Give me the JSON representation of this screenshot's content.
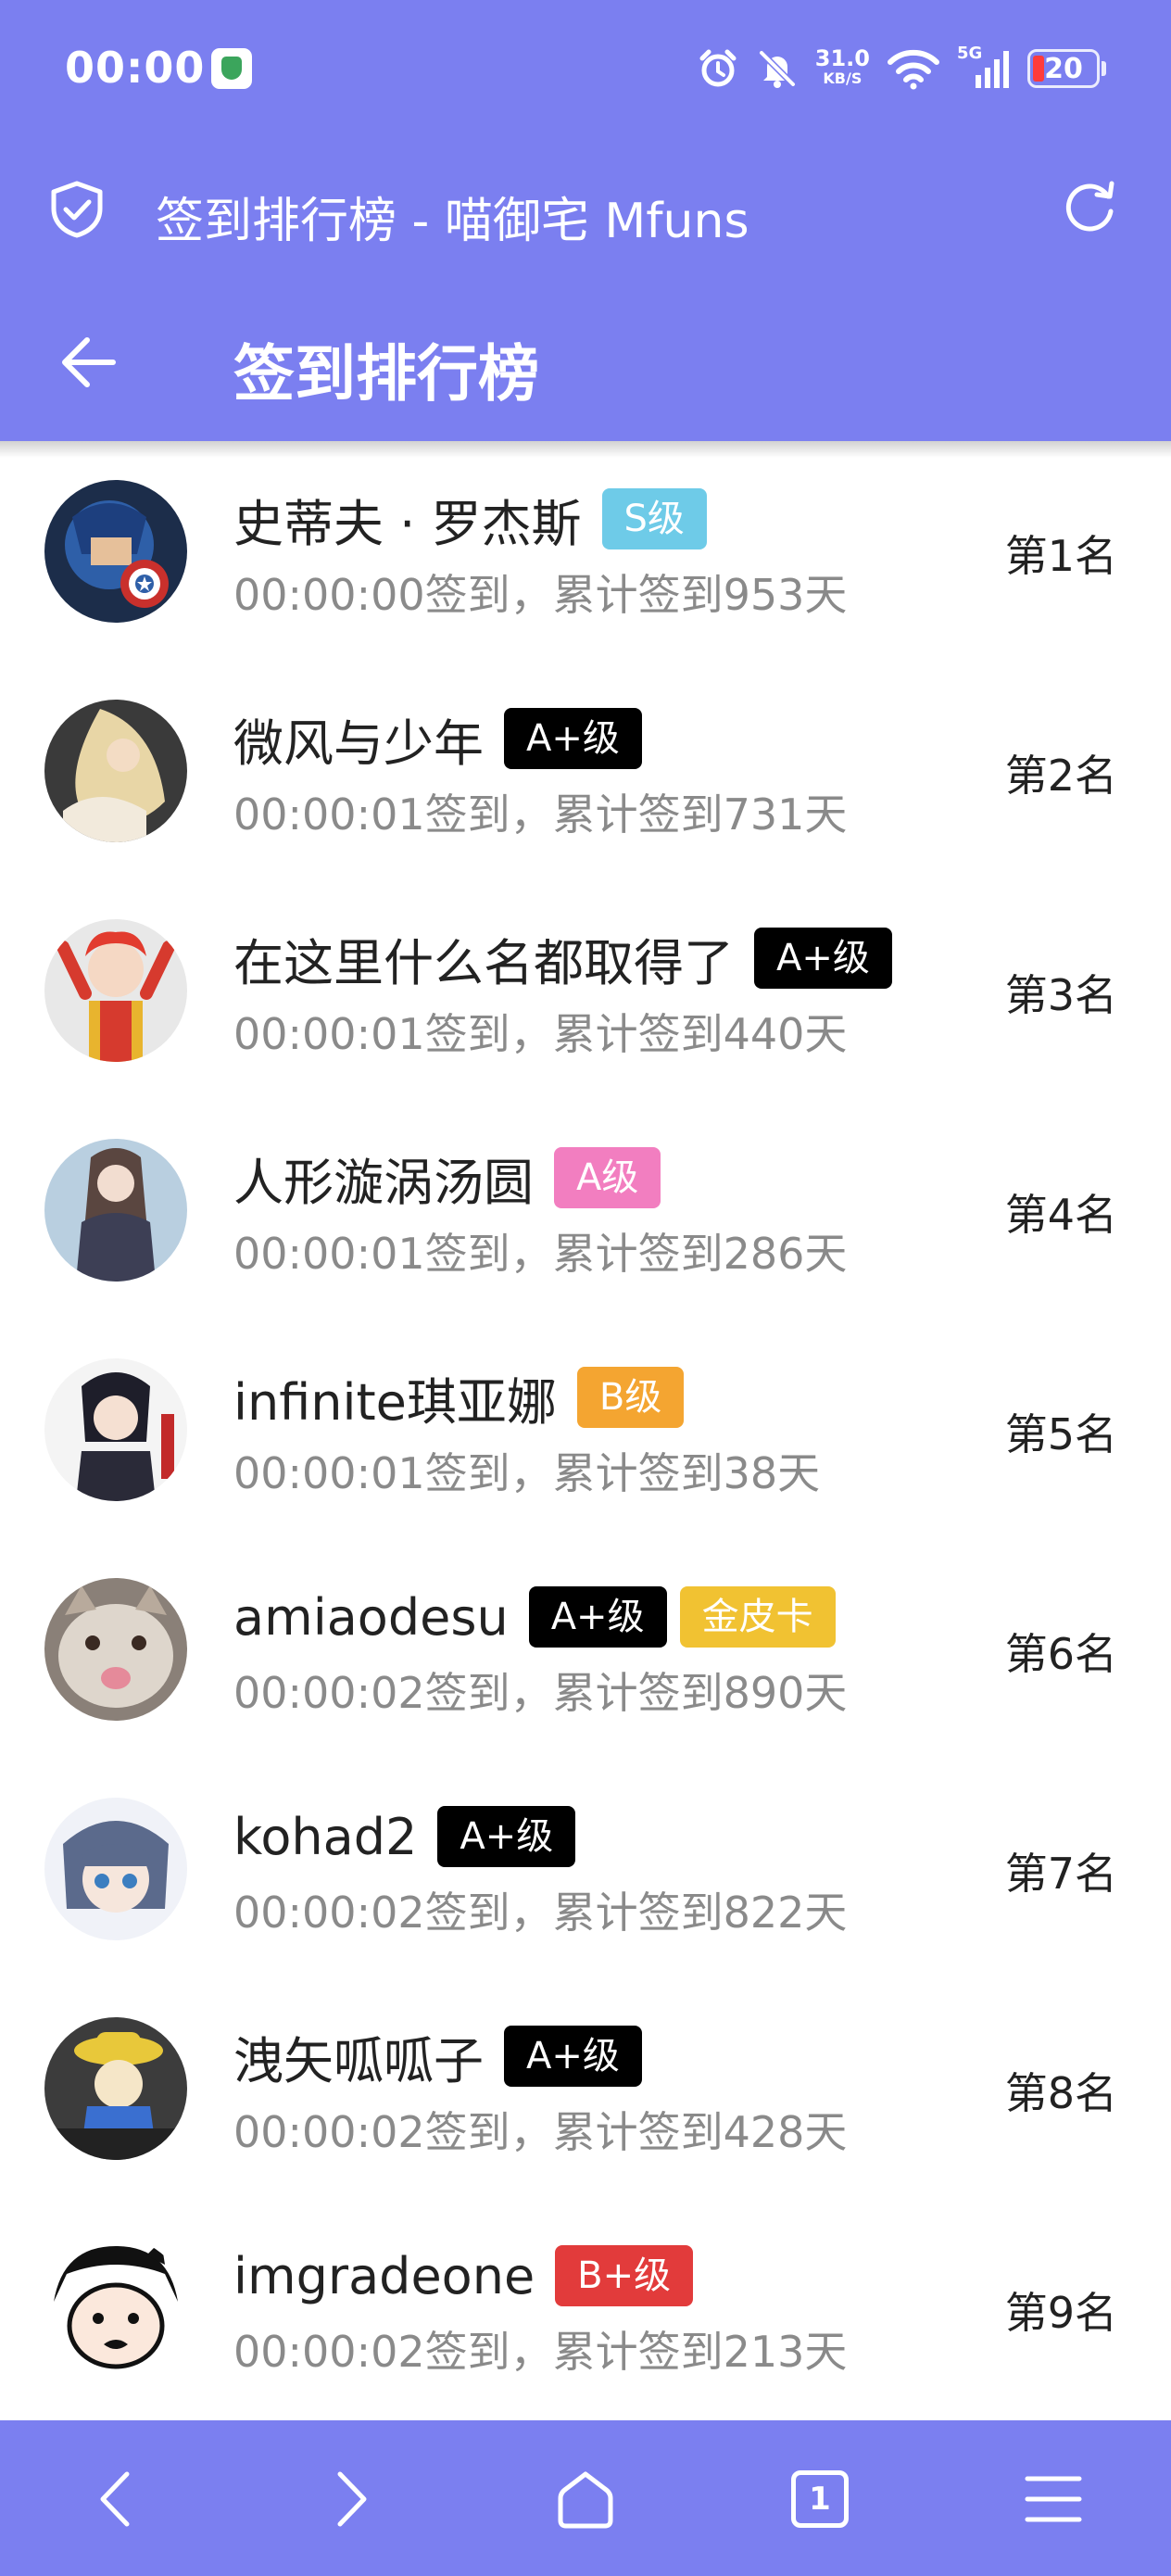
{
  "status_bar": {
    "time": "00:00",
    "net_speed": "31.0",
    "net_unit": "KB/S",
    "network": "5G",
    "battery": "20"
  },
  "browser": {
    "title": "签到排行榜 - 喵御宅 Mfuns"
  },
  "appbar": {
    "title": "签到排行榜"
  },
  "entries": [
    {
      "name": "史蒂夫 · 罗杰斯",
      "badges": [
        {
          "text": "S级",
          "color": "#6ecbe8"
        }
      ],
      "sub": "00:00:00签到，累计签到953天",
      "rank": "第1名"
    },
    {
      "name": "微风与少年",
      "badges": [
        {
          "text": "A+级",
          "color": "#000000"
        }
      ],
      "sub": "00:00:01签到，累计签到731天",
      "rank": "第2名"
    },
    {
      "name": "在这里什么名都取得了",
      "badges": [
        {
          "text": "A+级",
          "color": "#000000"
        }
      ],
      "sub": "00:00:01签到，累计签到440天",
      "rank": "第3名"
    },
    {
      "name": "人形漩涡汤圆",
      "badges": [
        {
          "text": "A级",
          "color": "#f27ec0"
        }
      ],
      "sub": "00:00:01签到，累计签到286天",
      "rank": "第4名"
    },
    {
      "name": "infinite琪亚娜",
      "badges": [
        {
          "text": "B级",
          "color": "#f4a531"
        }
      ],
      "sub": "00:00:01签到，累计签到38天",
      "rank": "第5名"
    },
    {
      "name": "amiaodesu",
      "badges": [
        {
          "text": "A+级",
          "color": "#000000"
        },
        {
          "text": "金皮卡",
          "color": "#f1c232"
        }
      ],
      "sub": "00:00:02签到，累计签到890天",
      "rank": "第6名"
    },
    {
      "name": "kohad2",
      "badges": [
        {
          "text": "A+级",
          "color": "#000000"
        }
      ],
      "sub": "00:00:02签到，累计签到822天",
      "rank": "第7名"
    },
    {
      "name": "洩矢呱呱子",
      "badges": [
        {
          "text": "A+级",
          "color": "#000000"
        }
      ],
      "sub": "00:00:02签到，累计签到428天",
      "rank": "第8名"
    },
    {
      "name": "imgradeone",
      "badges": [
        {
          "text": "B+级",
          "color": "#e23b3b"
        }
      ],
      "sub": "00:00:02签到，累计签到213天",
      "rank": "第9名"
    }
  ],
  "bottom_nav": {
    "tab_count": "1"
  },
  "colors": {
    "primary": "#7b7ff0"
  }
}
